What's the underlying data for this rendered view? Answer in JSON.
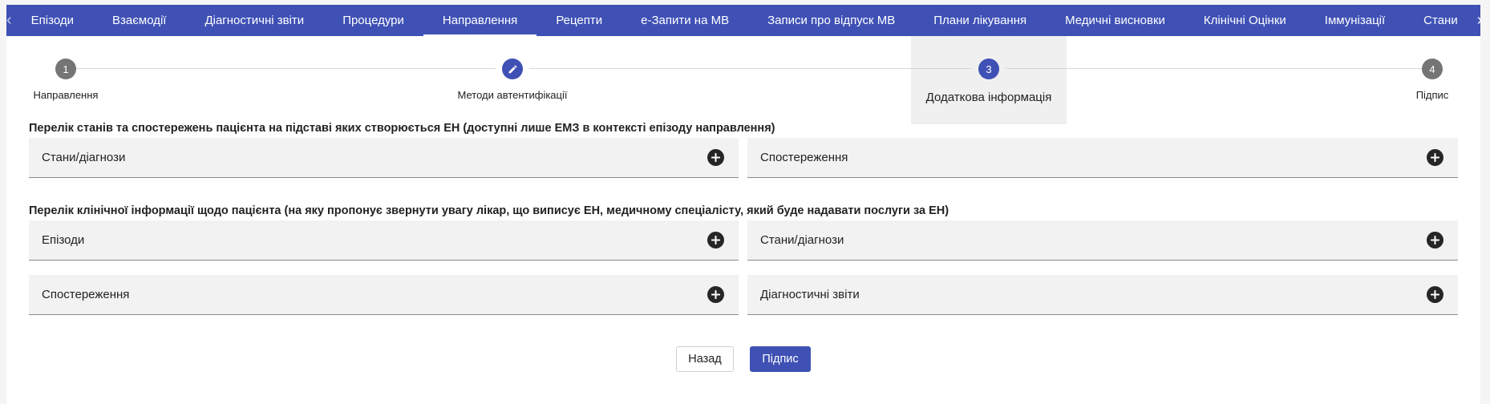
{
  "tabs": {
    "prev_arrow": "‹",
    "next_arrow": "›",
    "items": [
      {
        "label": "Епізоди"
      },
      {
        "label": "Взаємодії"
      },
      {
        "label": "Діагностичні звіти"
      },
      {
        "label": "Процедури"
      },
      {
        "label": "Направлення",
        "active": true
      },
      {
        "label": "Рецепти"
      },
      {
        "label": "е-Запити на МВ"
      },
      {
        "label": "Записи про відпуск МВ"
      },
      {
        "label": "Плани лікування"
      },
      {
        "label": "Медичні висновки"
      },
      {
        "label": "Клінічні Оцінки"
      },
      {
        "label": "Іммунізації"
      },
      {
        "label": "Стани"
      }
    ]
  },
  "stepper": {
    "steps": [
      {
        "number": "1",
        "label": "Направлення",
        "state": "done"
      },
      {
        "number": "",
        "label": "Методи автентифікації",
        "state": "edit",
        "icon": "pencil-icon"
      },
      {
        "number": "3",
        "label": "Додаткова інформація",
        "state": "current"
      },
      {
        "number": "4",
        "label": "Підпис",
        "state": "done"
      }
    ]
  },
  "section1": {
    "title": "Перелік станів та спостережень пацієнта на підставі яких створюється ЕН (доступні лише ЕМЗ в контексті епізоду направлення)",
    "panels": [
      {
        "label": "Стани/діагнози"
      },
      {
        "label": "Спостереження"
      }
    ]
  },
  "section2": {
    "title": "Перелік клінічної інформації щодо пацієнта (на яку пропонує звернути увагу лікар, що виписує ЕН, медичному спеціалісту, який буде надавати послуги за ЕН)",
    "panels": [
      {
        "label": "Епізоди"
      },
      {
        "label": "Стани/діагнози"
      },
      {
        "label": "Спостереження"
      },
      {
        "label": "Діагностичні звіти"
      }
    ]
  },
  "actions": {
    "back_label": "Назад",
    "sign_label": "Підпис"
  },
  "colors": {
    "primary": "#3f51b5",
    "step_done": "#757575",
    "panel_bg": "#f2f2f2"
  }
}
